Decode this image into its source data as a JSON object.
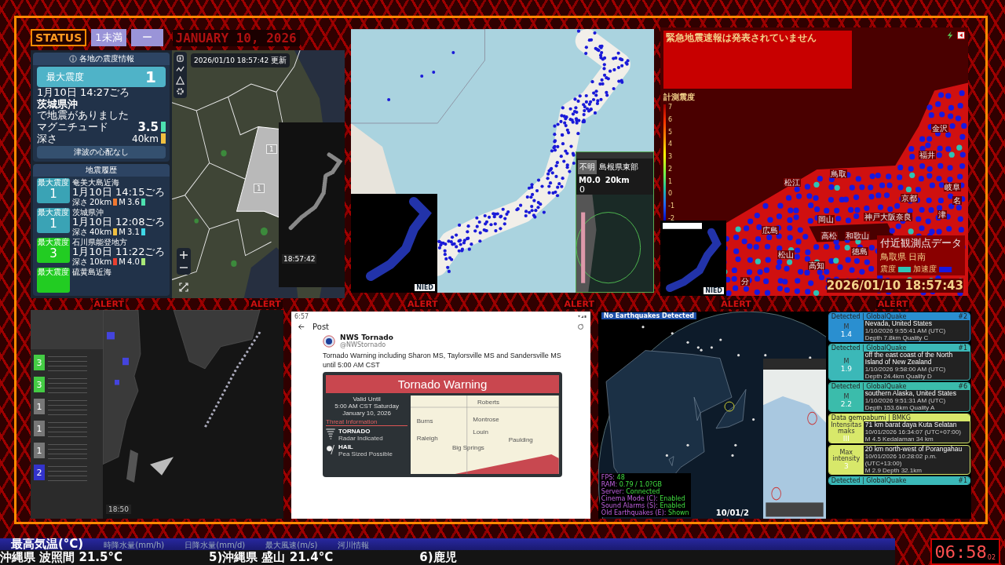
{
  "top_bar": {
    "status": "STATUS",
    "level": "1未満",
    "dash": "ー",
    "date": "JANUARY 10, 2026"
  },
  "alert_marks": [
    "ALERT",
    "ALERT",
    "ALERT",
    "ALERT",
    "ALERT",
    "ALERT"
  ],
  "quake_app": {
    "panel_title": "各地の震度情報",
    "max_label": "最大震度",
    "max_value": "1",
    "time": "1月10日 14:27ごろ",
    "place": "茨城県沖",
    "note": "で地震がありました",
    "magnitude": {
      "label": "マグニチュード",
      "value": "3.5",
      "color": "#4de0b0"
    },
    "depth": {
      "label": "深さ",
      "value": "40km",
      "color": "#f0c040"
    },
    "tsunami": "津波の心配なし",
    "history_title": "地震履歴",
    "history": [
      {
        "badge_label": "最大震度",
        "intensity": "1",
        "color": "#3aa3b5",
        "place": "奄美大島近海",
        "time": "1月10日 14:15ごろ",
        "depth": {
          "label": "深さ",
          "value": "20km",
          "color": "#f07830"
        },
        "mag": {
          "label": "M",
          "value": "3.6",
          "color": "#4de0b0"
        }
      },
      {
        "badge_label": "最大震度",
        "intensity": "1",
        "color": "#3aa3b5",
        "place": "茨城県沖",
        "time": "1月10日 12:08ごろ",
        "depth": {
          "label": "深さ",
          "value": "40km",
          "color": "#f0c040"
        },
        "mag": {
          "label": "M",
          "value": "3.1",
          "color": "#40d8e8"
        }
      },
      {
        "badge_label": "最大震度",
        "intensity": "3",
        "color": "#22cc22",
        "place": "石川県能登地方",
        "time": "1月10日 11:22ごろ",
        "depth": {
          "label": "深さ",
          "value": "10km",
          "color": "#e84030"
        },
        "mag": {
          "label": "M",
          "value": "4.0",
          "color": "#a8e878"
        }
      },
      {
        "badge_label": "最大震度",
        "color": "#22cc22",
        "place": "硫黄島近海"
      }
    ],
    "map_time": "2026/01/10 18:57:42",
    "map_updated": "更新",
    "map_badges": [
      "1",
      "1"
    ],
    "phone_time": "18:57:42"
  },
  "station_map": {
    "card_intensity": "0",
    "card_status": "不明",
    "card_region": "島根県東部",
    "card_magnitude": "M0.0",
    "card_depth": "20km",
    "inset_logo": "NIED"
  },
  "eew": {
    "message": "緊急地震速報は発表されていません",
    "scale_title": "計測震度",
    "scale_ticks": [
      "7",
      "6",
      "5",
      "4",
      "3",
      "2",
      "1",
      "0",
      "-1",
      "-2"
    ],
    "cities": [
      "松江",
      "鳥取",
      "福井",
      "金沢",
      "岐阜",
      "名",
      "京都",
      "神戸大阪奈良",
      "津",
      "岡山",
      "広島",
      "高松",
      "和歌山",
      "徳島",
      "松山",
      "高知",
      "分"
    ],
    "station_title": "付近観測点データ",
    "station": "鳥取県 日南",
    "legend": [
      {
        "label": "震度",
        "color": "#2ec4b6"
      },
      {
        "label": "加速度",
        "color": "#1818e0"
      }
    ],
    "time": "2026/01/10 18:57:43",
    "inset_logo": "NIED"
  },
  "radar": {
    "list": [
      {
        "intensity": "3",
        "color": "#44cc44"
      },
      {
        "intensity": "3",
        "color": "#44cc44"
      },
      {
        "intensity": "1",
        "color": "#777777"
      },
      {
        "intensity": "1",
        "color": "#777777"
      },
      {
        "intensity": "1",
        "color": "#777777"
      },
      {
        "intensity": "2",
        "color": "#3333cc"
      }
    ],
    "clock": "18:50"
  },
  "tweet": {
    "status_time": "6:57",
    "title": "Post",
    "name": "NWS Tornado",
    "handle": "@NWStornado",
    "text": "Tornado Warning including Sharon MS, Taylorsville MS and  Sandersville MS until 5:00 AM CST",
    "card_title": "Tornado Warning",
    "valid": [
      "Valid Until",
      "5:00 AM CST Saturday",
      "January 10, 2026"
    ],
    "threat_title": "Threat Information",
    "threats": [
      {
        "kind": "tornado",
        "name": "TORNADO",
        "detail": "Radar Indicated"
      },
      {
        "kind": "hail",
        "name": "HAIL",
        "detail": "Pea Sized Possible"
      }
    ],
    "towns": [
      "Roberts",
      "Burns",
      "Montrose",
      "Louin",
      "Raleigh",
      "Big Springs",
      "Paulding"
    ]
  },
  "globe": {
    "banner": "No Earthquakes Detected",
    "status_lines": [
      {
        "label": "FPS:",
        "value": "48"
      },
      {
        "label": "RAM:",
        "value": "0.79 / 1.0?GB"
      },
      {
        "label": "Server:",
        "value": "Connected"
      },
      {
        "label": "Cinema Mode (C):",
        "value": "Enabled"
      },
      {
        "label": "Sound Alarms (S):",
        "value": "Enabled"
      },
      {
        "label": "Old Earthquakes (E):",
        "value": "Shown"
      }
    ],
    "date": "10/01/2",
    "cards": [
      {
        "source": "Detected | GlobalQuake",
        "rank": "#2",
        "color": "#2a8fd0",
        "mag_label": "M",
        "value": "1.4",
        "place": "Nevada, United States",
        "time": "1/10/2026 9:55:41 AM (UTC)",
        "detail": "Depth 7.8km   Quality C"
      },
      {
        "source": "Detected | GlobalQuake",
        "rank": "#1",
        "color": "#3bb8b8",
        "mag_label": "M",
        "value": "1.9",
        "place": "off the east coast of the North Island of New Zealand",
        "time": "1/10/2026 9:58:00 AM (UTC)",
        "detail": "Depth 24.4km   Quality D"
      },
      {
        "source": "Detected | GlobalQuake",
        "rank": "#6",
        "color": "#3bbcab",
        "mag_label": "M",
        "value": "2.2",
        "place": "southern Alaska, United States",
        "time": "1/10/2026 9:51:31 AM (UTC)",
        "detail": "Depth 153.6km   Quality A"
      },
      {
        "source": "Data gempabumi | BMKG",
        "color": "#d8e86a",
        "mag_label": "Intensitas maks",
        "value": "III",
        "place": "71 km barat daya Kuta Selatan",
        "time": "10/01/2026 16:34:07 (UTC+07:00)",
        "detail": "M 4.5   Kedalaman 34 km"
      },
      {
        "color": "#d8e86a",
        "mag_label": "Max intensity",
        "value": "3",
        "place": "20 km north-west of Porangahau",
        "time": "10/01/2026 10:28:02 p.m. (UTC+13:00)",
        "detail": "M 2.9   Depth 32.1km"
      },
      {
        "source": "Detected | GlobalQuake",
        "rank": "#1",
        "color": "#3bb8b8"
      }
    ]
  },
  "ticker": {
    "tabs": [
      {
        "label": "最高気温(°C)",
        "selected": true
      },
      {
        "label": "時降水量(mm/h)",
        "selected": false
      },
      {
        "label": "日降水量(mm/d)",
        "selected": false
      },
      {
        "label": "最大風速(m/s)",
        "selected": false
      },
      {
        "label": "河川情報",
        "selected": false
      }
    ],
    "items": [
      "沖縄県 波照間 21.5°C",
      "5)沖縄県 盛山 21.4°C",
      "6)鹿児"
    ],
    "clock": "06:58",
    "seconds": "02"
  }
}
